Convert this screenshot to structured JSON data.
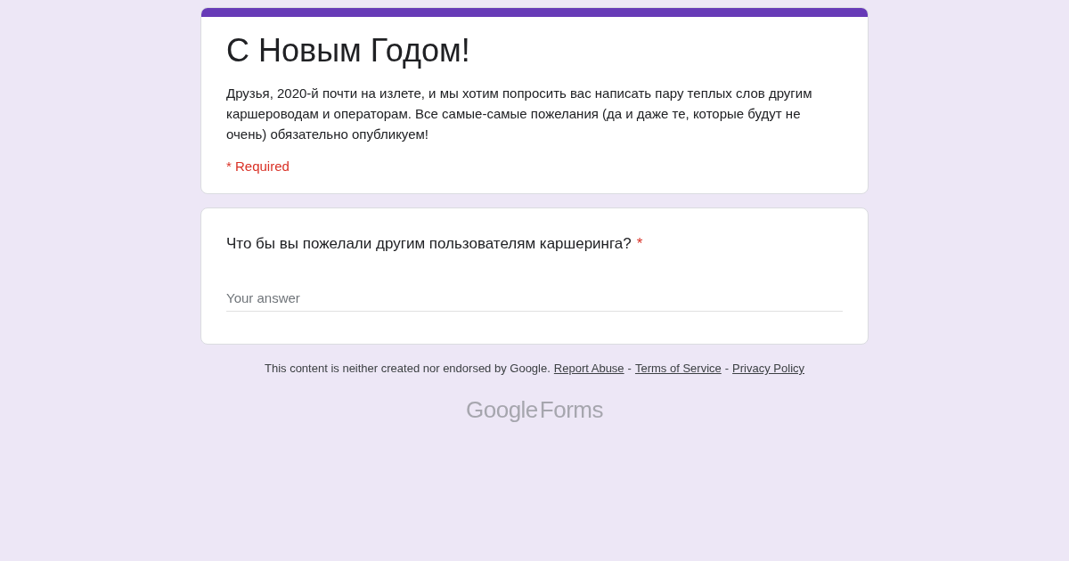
{
  "header": {
    "title": "С Новым Годом!",
    "description": "Друзья, 2020-й почти на излете, и мы хотим попросить вас написать пару теплых слов другим каршероводам и операторам. Все самые-самые пожелания (да и даже те, которые будут не очень) обязательно опубликуем!",
    "required_note": "* Required"
  },
  "question": {
    "text": "Что бы вы пожелали другим пользователям каршеринга?",
    "required": true,
    "required_mark": "*",
    "placeholder": "Your answer"
  },
  "footer": {
    "notice": "This content is neither created nor endorsed by Google.",
    "links": [
      "Report Abuse",
      "Terms of Service",
      "Privacy Policy"
    ],
    "separator": "-"
  },
  "logo": {
    "brand": "Google",
    "product": "Forms"
  }
}
